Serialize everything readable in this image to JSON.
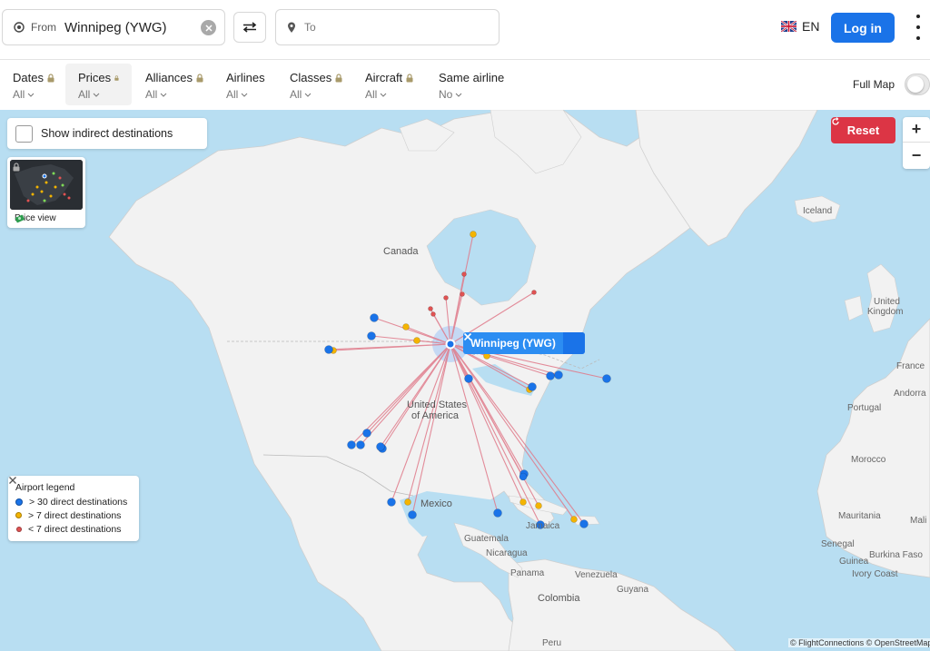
{
  "search": {
    "from_label": "From",
    "from_value": "Winnipeg (YWG)",
    "to_placeholder": "To"
  },
  "header": {
    "language": "EN",
    "login_label": "Log in"
  },
  "filters": [
    {
      "title": "Dates",
      "value": "All",
      "locked": true
    },
    {
      "title": "Prices",
      "value": "All",
      "locked": true
    },
    {
      "title": "Alliances",
      "value": "All",
      "locked": true
    },
    {
      "title": "Airlines",
      "value": "All",
      "locked": false
    },
    {
      "title": "Classes",
      "value": "All",
      "locked": true
    },
    {
      "title": "Aircraft",
      "value": "All",
      "locked": true
    },
    {
      "title": "Same airline",
      "value": "No",
      "locked": false
    }
  ],
  "full_map": {
    "label": "Full Map",
    "enabled": false
  },
  "map": {
    "show_indirect_label": "Show indirect destinations",
    "price_view_label": "Price view",
    "reset_label": "Reset",
    "zoom_in": "+",
    "zoom_out": "−",
    "selected_airport": "Winnipeg (YWG)",
    "attribution": "© FlightConnections © OpenStreetMap",
    "places": {
      "canada": "Canada",
      "united_states": "United States",
      "of_america": "of America",
      "mexico": "Mexico",
      "guatemala": "Guatemala",
      "nicaragua": "Nicaragua",
      "panama": "Panama",
      "venezuela": "Venezuela",
      "guyana": "Guyana",
      "colombia": "Colombia",
      "peru": "Peru",
      "jamaica": "Jamaica",
      "iceland": "Iceland",
      "united": "United",
      "kingdom": "Kingdom",
      "france": "France",
      "andorra": "Andorra",
      "portugal": "Portugal",
      "morocco": "Morocco",
      "mauritania": "Mauritania",
      "senegal": "Senegal",
      "guinea": "Guinea",
      "burkina_faso": "Burkina Faso",
      "ivory_coast": "Ivory Coast",
      "mali": "Mali"
    }
  },
  "legend": {
    "title": "Airport legend",
    "items": [
      {
        "label": "> 30 direct destinations",
        "color": "#1a73e8"
      },
      {
        "label": "> 7 direct destinations",
        "color": "#f4b400"
      },
      {
        "label": "< 7 direct destinations",
        "color": "#e05252"
      }
    ]
  },
  "colors": {
    "accent": "#1a73e8",
    "reset": "#dc3545",
    "route": "#e07a8a",
    "water": "#b8def2",
    "land": "#f2f2f2"
  }
}
